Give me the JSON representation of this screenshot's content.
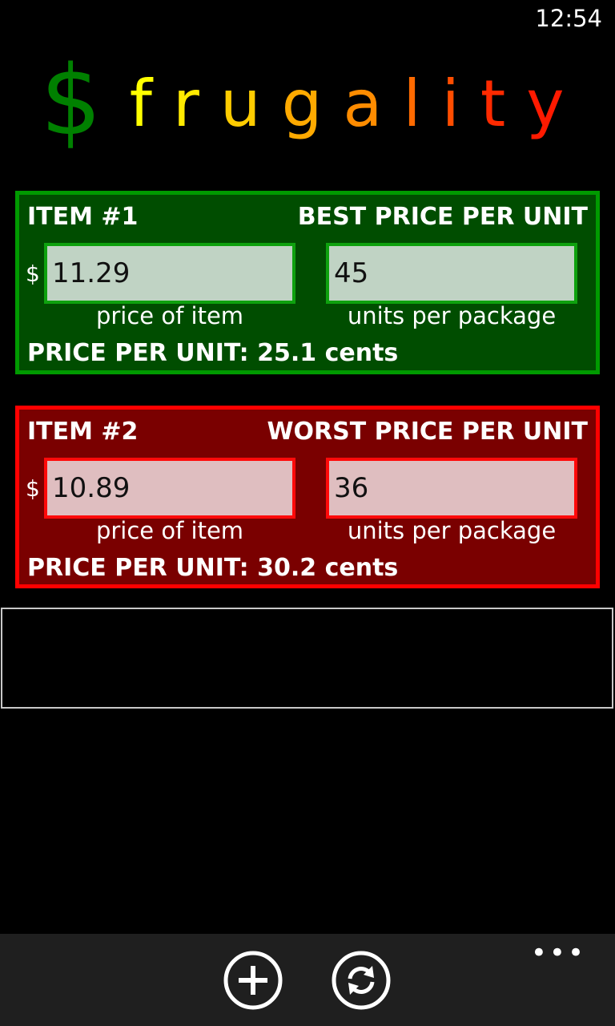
{
  "status_bar": {
    "time": "12:54"
  },
  "logo": {
    "dollar": "$",
    "letters": [
      "f",
      "r",
      "u",
      "g",
      "a",
      "l",
      "i",
      "t",
      "y"
    ],
    "dollar_color": "#008000",
    "letter_colors": [
      "#ffff00",
      "#ffea00",
      "#ffcc00",
      "#ffaa00",
      "#ff8c00",
      "#ff6a00",
      "#ff4d00",
      "#ff2a00",
      "#ff1a00"
    ]
  },
  "items": [
    {
      "title": "ITEM #1",
      "verdict": "BEST PRICE PER UNIT",
      "currency": "$",
      "price_value": "11.29",
      "price_caption": "price of item",
      "units_value": "45",
      "units_caption": "units per package",
      "result": "PRICE PER UNIT: 25.1 cents",
      "accent_color": "#009a00"
    },
    {
      "title": "ITEM #2",
      "verdict": "WORST PRICE PER UNIT",
      "currency": "$",
      "price_value": "10.89",
      "price_caption": "price of item",
      "units_value": "36",
      "units_caption": "units per package",
      "result": "PRICE PER UNIT: 30.2 cents",
      "accent_color": "#ff0000"
    }
  ],
  "app_bar": {
    "more_label": "•••",
    "buttons": [
      {
        "icon": "add-icon"
      },
      {
        "icon": "refresh-icon"
      }
    ]
  }
}
